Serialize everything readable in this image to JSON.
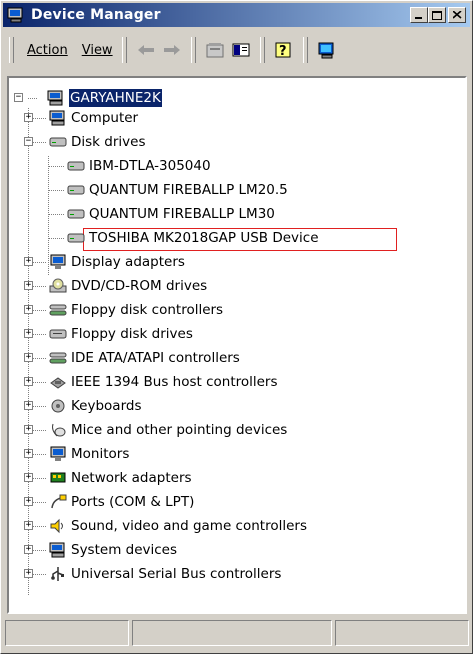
{
  "window": {
    "title": "Device Manager",
    "title_bar_color": "#0a246a"
  },
  "menubar": {
    "action_label": "Action",
    "view_label": "View"
  },
  "toolbar": {
    "icons": [
      "back-arrow-icon",
      "forward-arrow-icon",
      "properties-icon",
      "details-view-icon",
      "help-icon",
      "scan-hardware-icon"
    ]
  },
  "tree": {
    "root": "GARYAHNE2K",
    "categories": [
      {
        "label": "Computer",
        "icon": "computer-icon",
        "expanded": false
      },
      {
        "label": "Disk drives",
        "icon": "disk-drive-icon",
        "expanded": true,
        "children": [
          "IBM-DTLA-305040",
          "QUANTUM FIREBALLP LM20.5",
          "QUANTUM FIREBALLP LM30",
          "TOSHIBA MK2018GAP USB Device"
        ]
      },
      {
        "label": "Display adapters",
        "icon": "monitor-icon",
        "expanded": false
      },
      {
        "label": "DVD/CD-ROM drives",
        "icon": "cdrom-icon",
        "expanded": false
      },
      {
        "label": "Floppy disk controllers",
        "icon": "controller-icon",
        "expanded": false
      },
      {
        "label": "Floppy disk drives",
        "icon": "floppy-icon",
        "expanded": false
      },
      {
        "label": "IDE ATA/ATAPI controllers",
        "icon": "controller-icon",
        "expanded": false
      },
      {
        "label": "IEEE 1394 Bus host controllers",
        "icon": "firewire-icon",
        "expanded": false
      },
      {
        "label": "Keyboards",
        "icon": "keyboard-icon",
        "expanded": false
      },
      {
        "label": "Mice and other pointing devices",
        "icon": "mouse-icon",
        "expanded": false
      },
      {
        "label": "Monitors",
        "icon": "monitor-icon",
        "expanded": false
      },
      {
        "label": "Network adapters",
        "icon": "network-icon",
        "expanded": false
      },
      {
        "label": "Ports (COM & LPT)",
        "icon": "port-icon",
        "expanded": false
      },
      {
        "label": "Sound, video and game controllers",
        "icon": "speaker-icon",
        "expanded": false
      },
      {
        "label": "System devices",
        "icon": "computer-icon",
        "expanded": false
      },
      {
        "label": "Universal Serial Bus controllers",
        "icon": "usb-icon",
        "expanded": false
      }
    ],
    "highlighted_item": "TOSHIBA MK2018GAP USB Device",
    "highlight_color": "#e02020"
  }
}
